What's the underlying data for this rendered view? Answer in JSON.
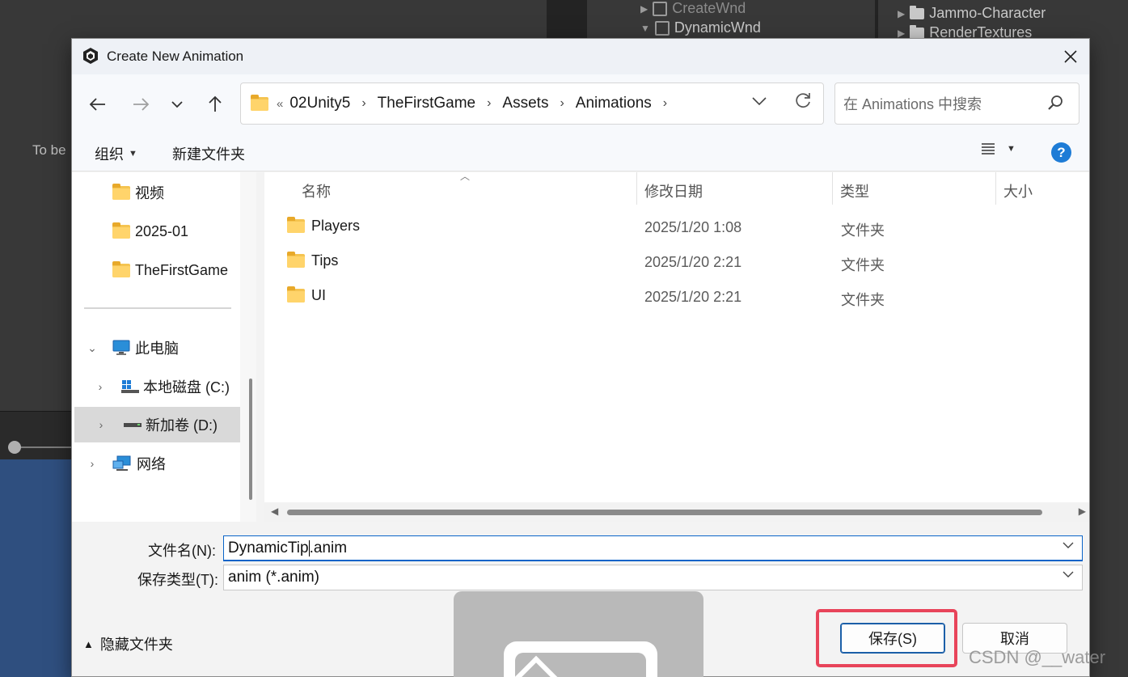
{
  "background": {
    "hierarchy_items": [
      {
        "label": "CreateWnd",
        "icon": "cube-icon"
      },
      {
        "label": "DynamicWnd",
        "icon": "cube-icon"
      }
    ],
    "project_items": [
      {
        "label": "Jammo-Character",
        "icon": "folder-icon"
      },
      {
        "label": "RenderTextures",
        "icon": "folder-icon"
      }
    ],
    "scene_text": "To be"
  },
  "dialog": {
    "title": "Create New Animation",
    "close_icon": "close-icon",
    "nav": {
      "back": "←",
      "forward": "→",
      "recent": "⌄",
      "up": "↑"
    },
    "address": {
      "overflow": "«",
      "crumbs": [
        "02Unity5",
        "TheFirstGame",
        "Assets",
        "Animations"
      ]
    },
    "search": {
      "placeholder": "在 Animations 中搜索"
    },
    "toolbar": {
      "organize": "组织",
      "new_folder": "新建文件夹",
      "help": "?"
    },
    "nav_pane": {
      "quick_access": [
        "视频",
        "2025-01",
        "TheFirstGame"
      ],
      "this_pc": "此电脑",
      "drives": [
        {
          "label": "本地磁盘 (C:)",
          "selected": false
        },
        {
          "label": "新加卷 (D:)",
          "selected": true
        }
      ],
      "network": "网络"
    },
    "columns": {
      "name": "名称",
      "date": "修改日期",
      "type": "类型",
      "size": "大小"
    },
    "files": [
      {
        "name": "Players",
        "date": "2025/1/20 1:08",
        "type": "文件夹"
      },
      {
        "name": "Tips",
        "date": "2025/1/20 2:21",
        "type": "文件夹"
      },
      {
        "name": "UI",
        "date": "2025/1/20 2:21",
        "type": "文件夹"
      }
    ],
    "filename": {
      "label": "文件名(N):",
      "value_before_cursor": "DynamicTip",
      "value_after_cursor": ".anim"
    },
    "filetype": {
      "label": "保存类型(T):",
      "value": "anim (*.anim)"
    },
    "footer": {
      "hide_folders": "隐藏文件夹",
      "save": "保存(S)",
      "cancel": "取消"
    }
  },
  "watermark": "CSDN @__water",
  "colors": {
    "accent": "#0a64c8",
    "highlight": "#e8445a",
    "help": "#1e7cd6"
  }
}
